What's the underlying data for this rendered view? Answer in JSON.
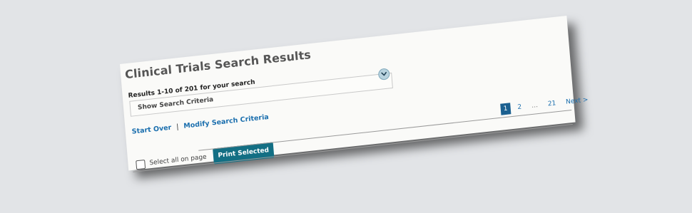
{
  "page": {
    "title": "Clinical Trials Search Results",
    "results_count": "Results 1-10 of 201 for your search"
  },
  "criteria": {
    "toggle_label": "Show Search Criteria",
    "toggle_icon": "chevron-down-icon"
  },
  "links": {
    "start_over": "Start Over",
    "separator": "|",
    "modify": "Modify Search Criteria"
  },
  "pagination": {
    "pages": [
      "1",
      "2",
      "…",
      "21"
    ],
    "current": "1",
    "next": "Next >"
  },
  "selection": {
    "select_all_label": "Select all on page",
    "print_label": "Print Selected"
  },
  "colors": {
    "link": "#1b6fae",
    "button": "#136f84",
    "active_page": "#1b6090"
  }
}
